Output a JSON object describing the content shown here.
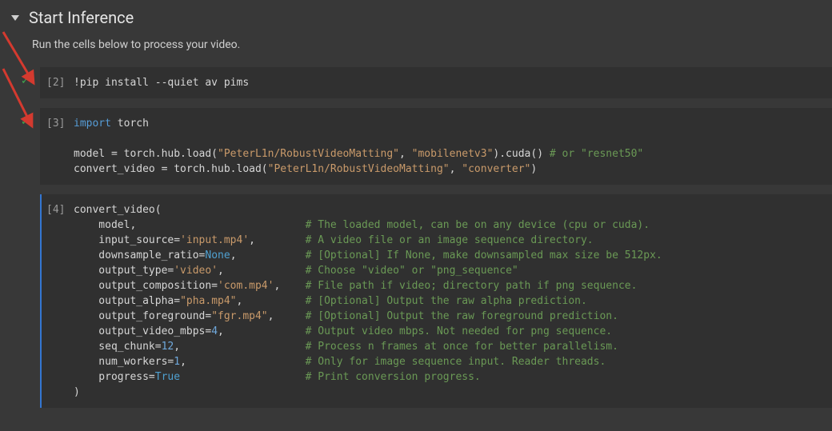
{
  "section": {
    "title": "Start Inference",
    "description": "Run the cells below to process your video."
  },
  "cells": [
    {
      "id": "cell1",
      "prompt": "[2]",
      "executed": true,
      "tokens": [
        {
          "t": "!pip install --quiet av pims",
          "c": ""
        }
      ]
    },
    {
      "id": "cell2",
      "prompt": "[3]",
      "executed": true,
      "lines": [
        [
          {
            "t": "import",
            "c": "kw"
          },
          {
            "t": " torch",
            "c": ""
          }
        ],
        [],
        [
          {
            "t": "model = torch.hub.load(",
            "c": ""
          },
          {
            "t": "\"PeterL1n/RobustVideoMatting\"",
            "c": "str"
          },
          {
            "t": ", ",
            "c": ""
          },
          {
            "t": "\"mobilenetv3\"",
            "c": "str"
          },
          {
            "t": ").cuda() ",
            "c": ""
          },
          {
            "t": "# or \"resnet50\"",
            "c": "cmt"
          }
        ],
        [
          {
            "t": "convert_video = torch.hub.load(",
            "c": ""
          },
          {
            "t": "\"PeterL1n/RobustVideoMatting\"",
            "c": "str"
          },
          {
            "t": ", ",
            "c": ""
          },
          {
            "t": "\"converter\"",
            "c": "str"
          },
          {
            "t": ")",
            "c": ""
          }
        ]
      ]
    },
    {
      "id": "cell3",
      "prompt": "[4]",
      "executed": false,
      "selected": true,
      "lines": [
        [
          {
            "t": "convert_video(",
            "c": ""
          }
        ],
        [
          {
            "t": "    model,                           ",
            "c": ""
          },
          {
            "t": "# The loaded model, can be on any device (cpu or cuda).",
            "c": "cmt"
          }
        ],
        [
          {
            "t": "    input_source=",
            "c": ""
          },
          {
            "t": "'input.mp4'",
            "c": "str"
          },
          {
            "t": ",        ",
            "c": ""
          },
          {
            "t": "# A video file or an image sequence directory.",
            "c": "cmt"
          }
        ],
        [
          {
            "t": "    downsample_ratio=",
            "c": ""
          },
          {
            "t": "None",
            "c": "lit"
          },
          {
            "t": ",           ",
            "c": ""
          },
          {
            "t": "# [Optional] If None, make downsampled max size be 512px.",
            "c": "cmt"
          }
        ],
        [
          {
            "t": "    output_type=",
            "c": ""
          },
          {
            "t": "'video'",
            "c": "str"
          },
          {
            "t": ",             ",
            "c": ""
          },
          {
            "t": "# Choose \"video\" or \"png_sequence\"",
            "c": "cmt"
          }
        ],
        [
          {
            "t": "    output_composition=",
            "c": ""
          },
          {
            "t": "'com.mp4'",
            "c": "str"
          },
          {
            "t": ",    ",
            "c": ""
          },
          {
            "t": "# File path if video; directory path if png sequence.",
            "c": "cmt"
          }
        ],
        [
          {
            "t": "    output_alpha=",
            "c": ""
          },
          {
            "t": "\"pha.mp4\"",
            "c": "str"
          },
          {
            "t": ",          ",
            "c": ""
          },
          {
            "t": "# [Optional] Output the raw alpha prediction.",
            "c": "cmt"
          }
        ],
        [
          {
            "t": "    output_foreground=",
            "c": ""
          },
          {
            "t": "\"fgr.mp4\"",
            "c": "str"
          },
          {
            "t": ",     ",
            "c": ""
          },
          {
            "t": "# [Optional] Output the raw foreground prediction.",
            "c": "cmt"
          }
        ],
        [
          {
            "t": "    output_video_mbps=",
            "c": ""
          },
          {
            "t": "4",
            "c": "num"
          },
          {
            "t": ",             ",
            "c": ""
          },
          {
            "t": "# Output video mbps. Not needed for png sequence.",
            "c": "cmt"
          }
        ],
        [
          {
            "t": "    seq_chunk=",
            "c": ""
          },
          {
            "t": "12",
            "c": "num"
          },
          {
            "t": ",                    ",
            "c": ""
          },
          {
            "t": "# Process n frames at once for better parallelism.",
            "c": "cmt"
          }
        ],
        [
          {
            "t": "    num_workers=",
            "c": ""
          },
          {
            "t": "1",
            "c": "num"
          },
          {
            "t": ",                   ",
            "c": ""
          },
          {
            "t": "# Only for image sequence input. Reader threads.",
            "c": "cmt"
          }
        ],
        [
          {
            "t": "    progress=",
            "c": ""
          },
          {
            "t": "True",
            "c": "lit"
          },
          {
            "t": "                    ",
            "c": ""
          },
          {
            "t": "# Print conversion progress.",
            "c": "cmt"
          }
        ],
        [
          {
            "t": ")",
            "c": ""
          }
        ]
      ]
    }
  ]
}
